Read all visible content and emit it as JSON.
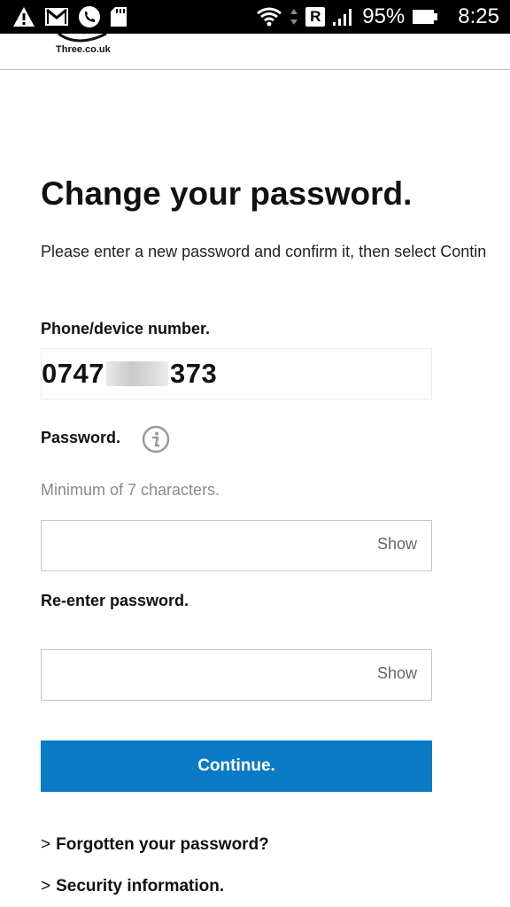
{
  "status_bar": {
    "battery_percent": "95%",
    "time": "8:25",
    "roaming_badge": "R",
    "icons_left": [
      "warning-icon",
      "gmail-icon",
      "phone-icon",
      "sd-card-icon"
    ],
    "icons_right": [
      "wifi-icon",
      "roaming-icon",
      "signal-icon",
      "battery-icon"
    ]
  },
  "header": {
    "logo_text": "Three.co.uk"
  },
  "page": {
    "title": "Change your password.",
    "intro": "Please enter a new password and confirm it, then select Contin",
    "phone_label": "Phone/device number.",
    "phone_prefix": "0747",
    "phone_suffix": "373",
    "password_label": "Password.",
    "password_hint": "Minimum of 7 characters.",
    "password_show": "Show",
    "reenter_label": "Re-enter password.",
    "reenter_show": "Show",
    "continue_label": "Continue.",
    "link_arrow": ">",
    "forgot_link": "Forgotten your password?",
    "security_link": "Security information."
  },
  "colors": {
    "accent": "#0a7ac6",
    "status_bar": "#000000",
    "hint": "#8a8a8a"
  }
}
